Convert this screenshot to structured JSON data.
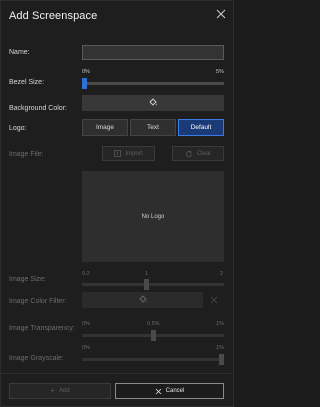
{
  "dialog": {
    "title": "Add Screenspace",
    "close_icon": "close-icon"
  },
  "form": {
    "name": {
      "label": "Name:",
      "value": ""
    },
    "bezel": {
      "label": "Bezel Size:",
      "min_label": "0%",
      "max_label": "5%",
      "value_percent": 0
    },
    "background_color": {
      "label": "Background Color:",
      "icon": "paint-bucket-icon"
    },
    "logo": {
      "label": "Logo:",
      "options": [
        "Image",
        "Text",
        "Default"
      ],
      "selected": "Default"
    },
    "image_file": {
      "label": "Image File:",
      "import_label": "Import",
      "clear_label": "Clear",
      "import_icon": "import-icon",
      "clear_icon": "refresh-icon"
    },
    "preview": {
      "text": "No Logo"
    },
    "image_size": {
      "label": "Image Size:",
      "min_label": "0.2",
      "mid_label": "1",
      "max_label": "2",
      "value": 1
    },
    "image_color_filter": {
      "label": "Image Color Filter:",
      "icon": "paint-bucket-icon",
      "clear_icon": "close-icon"
    },
    "image_transparency": {
      "label": "Image Transparency:",
      "min_label": "0%",
      "mid_label": "0.5%",
      "max_label": "1%",
      "value_percent": 0.5
    },
    "image_grayscale": {
      "label": "Image Grayscale:",
      "min_label": "0%",
      "max_label": "1%",
      "value_percent": 1
    }
  },
  "footer": {
    "add_label": "Add",
    "cancel_label": "Cancel",
    "add_icon": "plus-icon",
    "cancel_icon": "close-icon"
  },
  "colors": {
    "accent": "#3a7be6",
    "selected_bg": "#1a3a78",
    "dialog_bg": "#1e1e1e"
  }
}
